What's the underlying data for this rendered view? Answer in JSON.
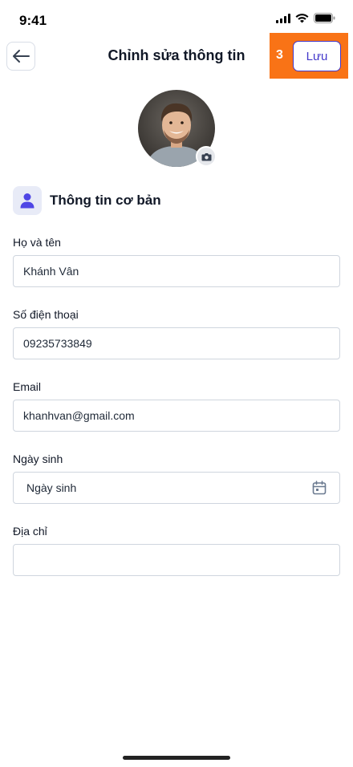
{
  "status_bar": {
    "time": "9:41"
  },
  "header": {
    "title": "Chỉnh sửa thông tin",
    "save_label": "Lưu",
    "step_badge": "3"
  },
  "section": {
    "title": "Thông tin cơ bản"
  },
  "form": {
    "full_name": {
      "label": "Họ và tên",
      "value": "Khánh Vân"
    },
    "phone": {
      "label": "Số điện thoại",
      "value": "09235733849"
    },
    "email": {
      "label": "Email",
      "value": "khanhvan@gmail.com"
    },
    "birthday": {
      "label": "Ngày sinh",
      "placeholder": "Ngày sinh"
    },
    "address": {
      "label": "Địa chỉ",
      "value": ""
    }
  },
  "colors": {
    "accent": "#4338ca",
    "highlight": "#f97316",
    "section_icon_bg": "#e8ebf7"
  },
  "icons": [
    "back-arrow-icon",
    "camera-icon",
    "user-icon",
    "calendar-icon",
    "signal-icon",
    "wifi-icon",
    "battery-icon"
  ]
}
